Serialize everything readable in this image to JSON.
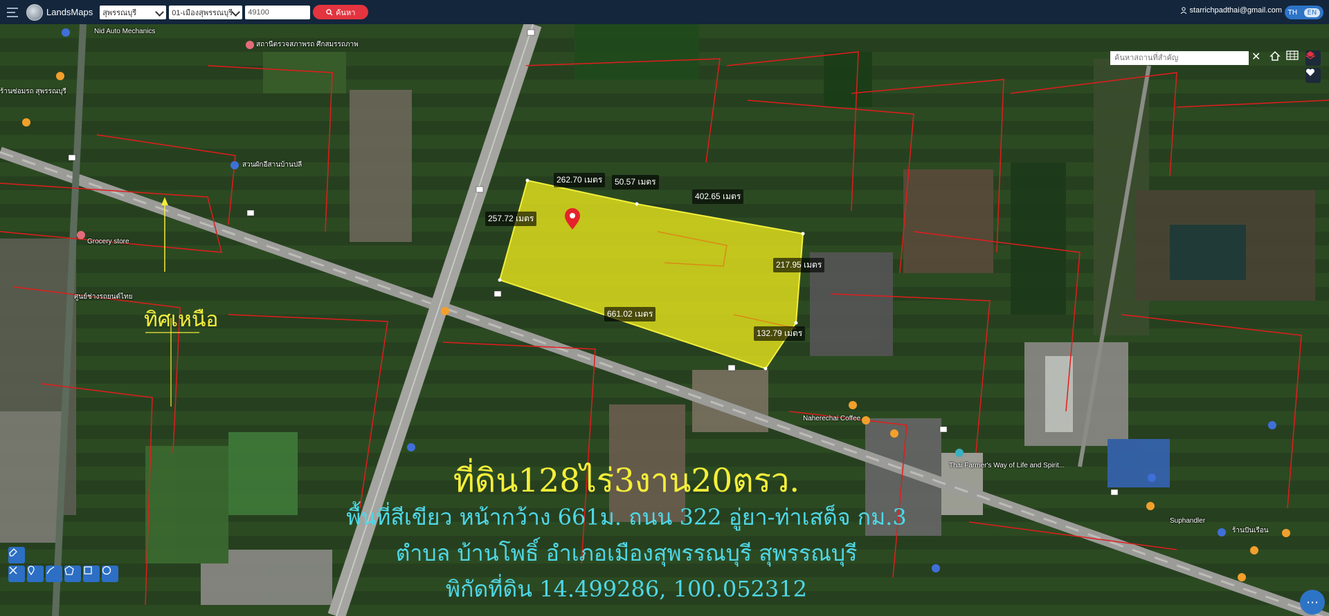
{
  "topbar": {
    "brand": "LandsMaps",
    "province": "สุพรรณบุรี",
    "district": "01-เมืองสุพรรณบุรี",
    "postcode": "49100",
    "search_label": "ค้นหา",
    "user_email": "starrichpadthai@gmail.com",
    "lang_th": "TH",
    "lang_en": "EN"
  },
  "map_search": {
    "placeholder": "ค้นหาสถานที่สำคัญ"
  },
  "places": {
    "p1": "Nid Auto Mechanics",
    "p2": "สถานีตรวจสภาพรถ ศึกสมรรถภาพ",
    "p3": "ร้านซ่อมรถ สุพรรณบุรี",
    "p4": "สวนผักอีสานบ้านปลี",
    "p5": "Grocery store",
    "p6": "ศูนย์ช่างรถยนต์ไทย",
    "p7": "Naherechai Coffee",
    "p8": "Thai Farmer's Way of Life and Spirit...",
    "p9": "Suphandler",
    "p10": "ร้านปันเรือน"
  },
  "measurements": {
    "m1": "262.70 เมตร",
    "m2": "50.57 เมตร",
    "m3": "402.65 เมตร",
    "m4": "257.72 เมตร",
    "m5": "217.95 เมตร",
    "m6": "661.02 เมตร",
    "m7": "132.79 เมตร"
  },
  "north_label": "ทิศเหนือ",
  "captions": {
    "line1": "ที่ดิน128ไร่3งาน20ตรว.",
    "line2": "พื้นที่สีเขียว หน้ากว้าง 661ม. ถนน 322 อู่ยา-ท่าเสด็จ กม.3",
    "line3": "ตำบล บ้านโพธิ์ อำเภอเมืองสุพรรณบุรี สุพรรณบุรี",
    "line4": "พิกัดที่ดิน 14.499286, 100.052312"
  },
  "colors": {
    "topbar": "#13263c",
    "parcel_fill": "#e4e21c",
    "boundary": "#e31c1c",
    "caption_title": "#f5ee3a",
    "caption_text": "#4fd7e6",
    "accent": "#e3343f"
  },
  "icons": [
    "menu-icon",
    "search-icon",
    "user-icon",
    "home-icon",
    "grid-icon",
    "layers-icon",
    "heart-icon",
    "eraser-icon",
    "map-pin-icon",
    "ruler-icon",
    "polygon-icon",
    "rectangle-icon",
    "circle-icon",
    "chat-icon"
  ]
}
